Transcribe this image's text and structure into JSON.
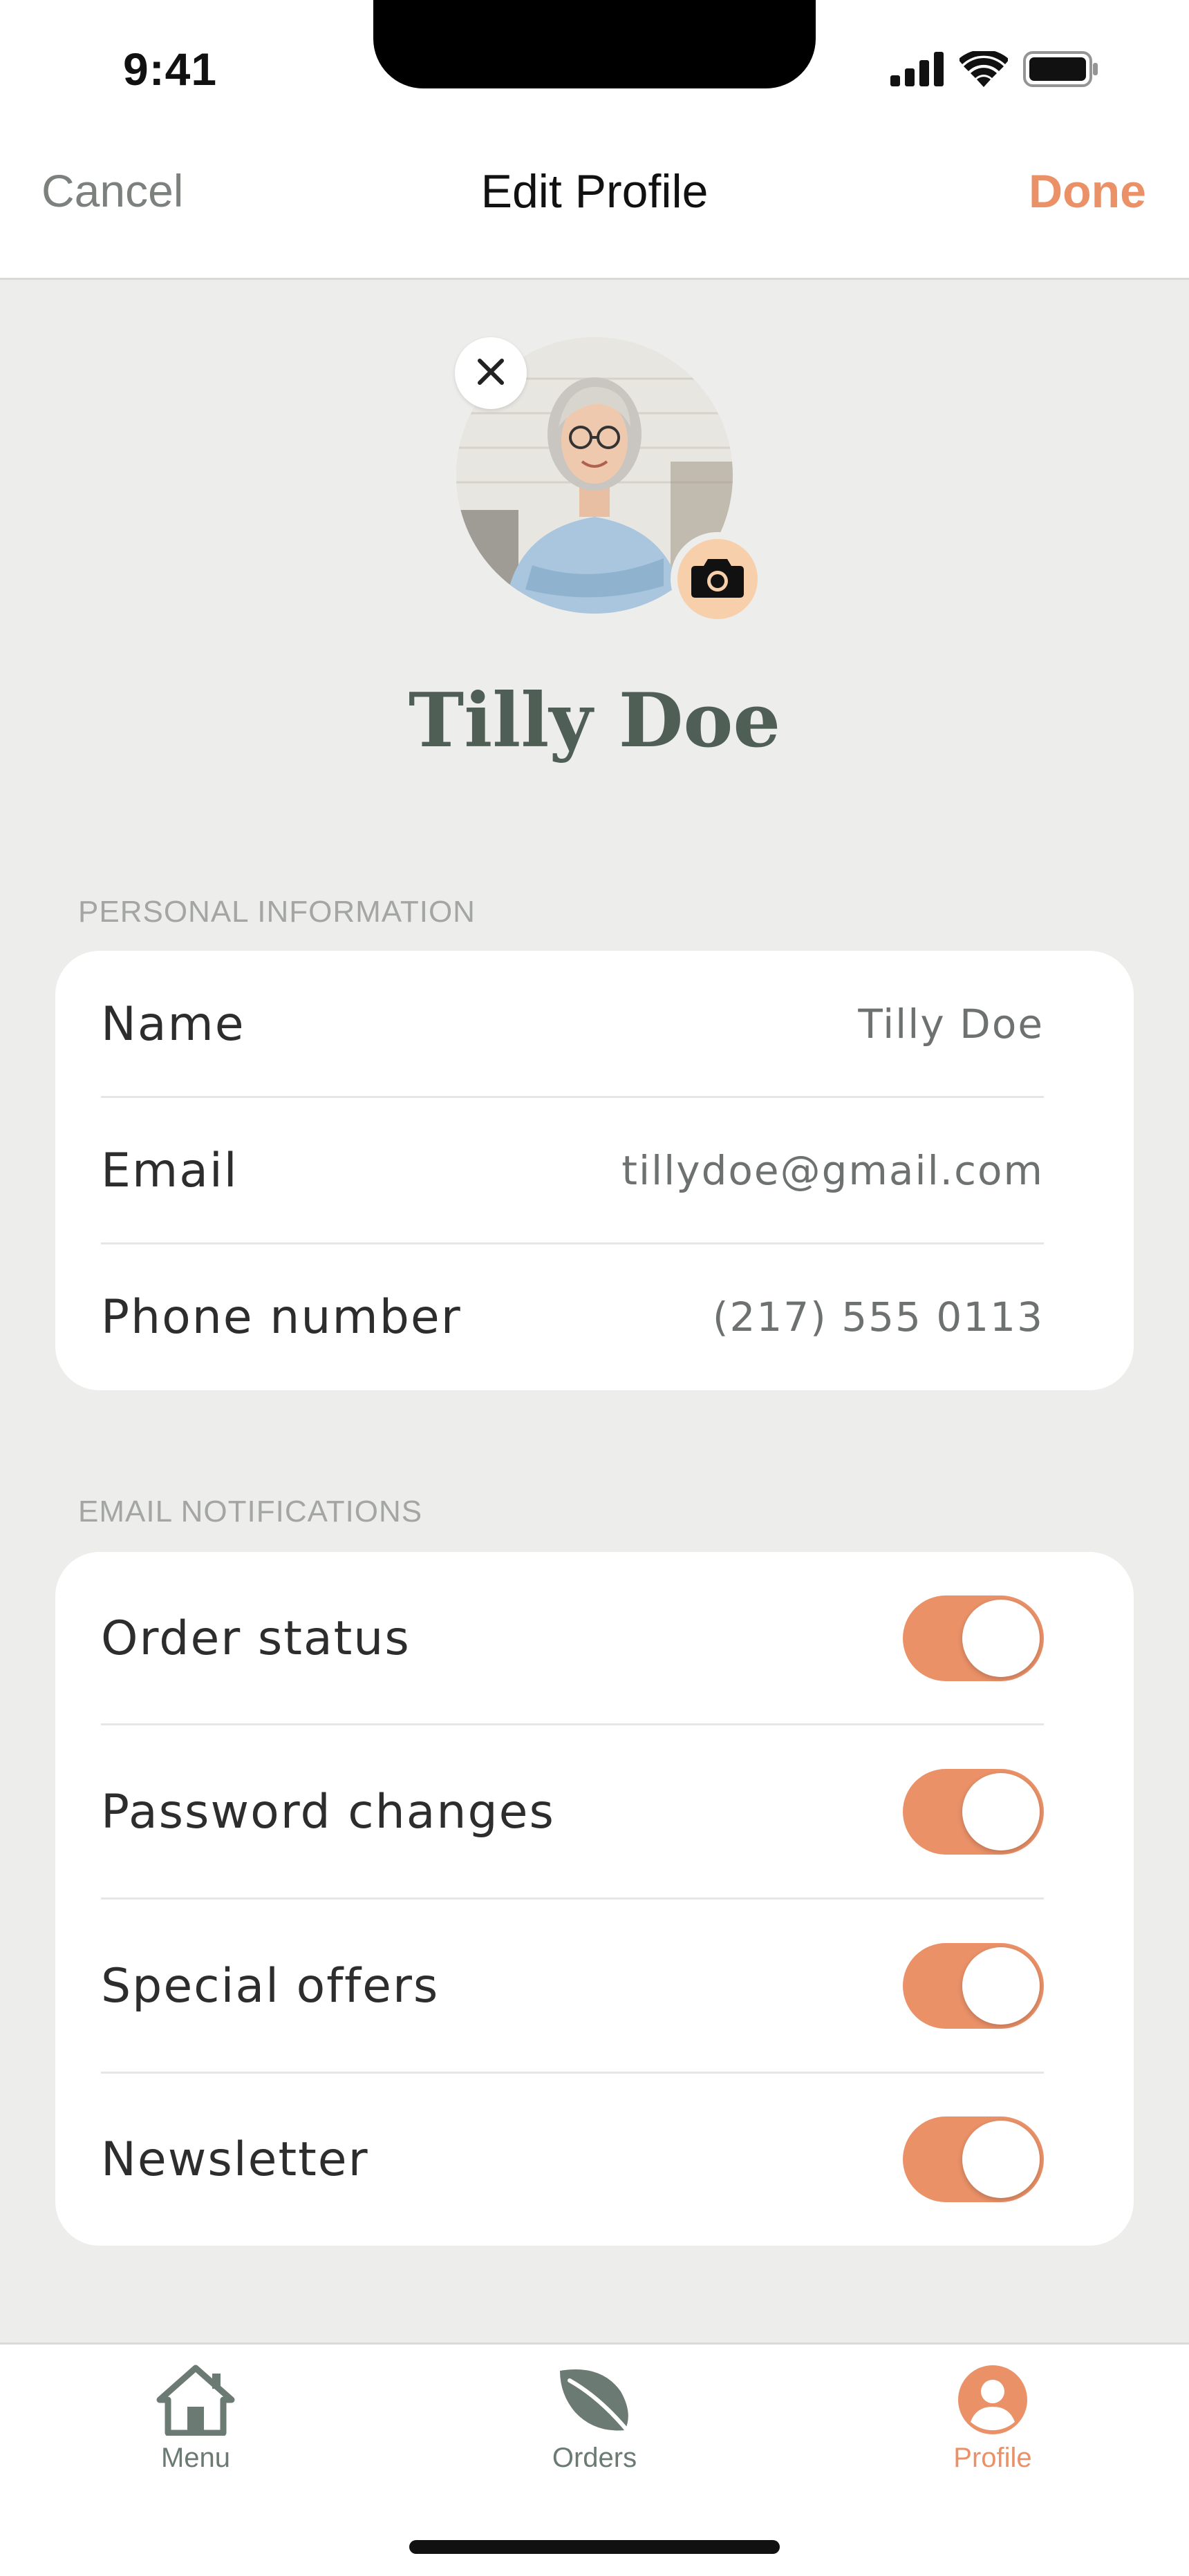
{
  "status_bar": {
    "time": "9:41"
  },
  "nav": {
    "cancel_label": "Cancel",
    "title": "Edit Profile",
    "done_label": "Done"
  },
  "profile": {
    "name": "Tilly Doe"
  },
  "personal_information": {
    "section_label": "PERSONAL INFORMATION",
    "rows": [
      {
        "label": "Name",
        "value": "Tilly Doe"
      },
      {
        "label": "Email",
        "value": "tillydoe@gmail.com"
      },
      {
        "label": "Phone number",
        "value": "(217) 555 0113"
      }
    ]
  },
  "email_notifications": {
    "section_label": "EMAIL NOTIFICATIONS",
    "rows": [
      {
        "label": "Order status",
        "enabled": true
      },
      {
        "label": "Password changes",
        "enabled": true
      },
      {
        "label": "Special offers",
        "enabled": true
      },
      {
        "label": "Newsletter",
        "enabled": true
      }
    ]
  },
  "tab_bar": {
    "tabs": [
      {
        "label": "Menu",
        "icon": "home-icon",
        "active": false
      },
      {
        "label": "Orders",
        "icon": "leaf-icon",
        "active": false
      },
      {
        "label": "Profile",
        "icon": "user-icon",
        "active": true
      }
    ]
  },
  "colors": {
    "accent": "#ea9168",
    "inactive": "#6b7a72",
    "heading": "#4f5f56"
  }
}
